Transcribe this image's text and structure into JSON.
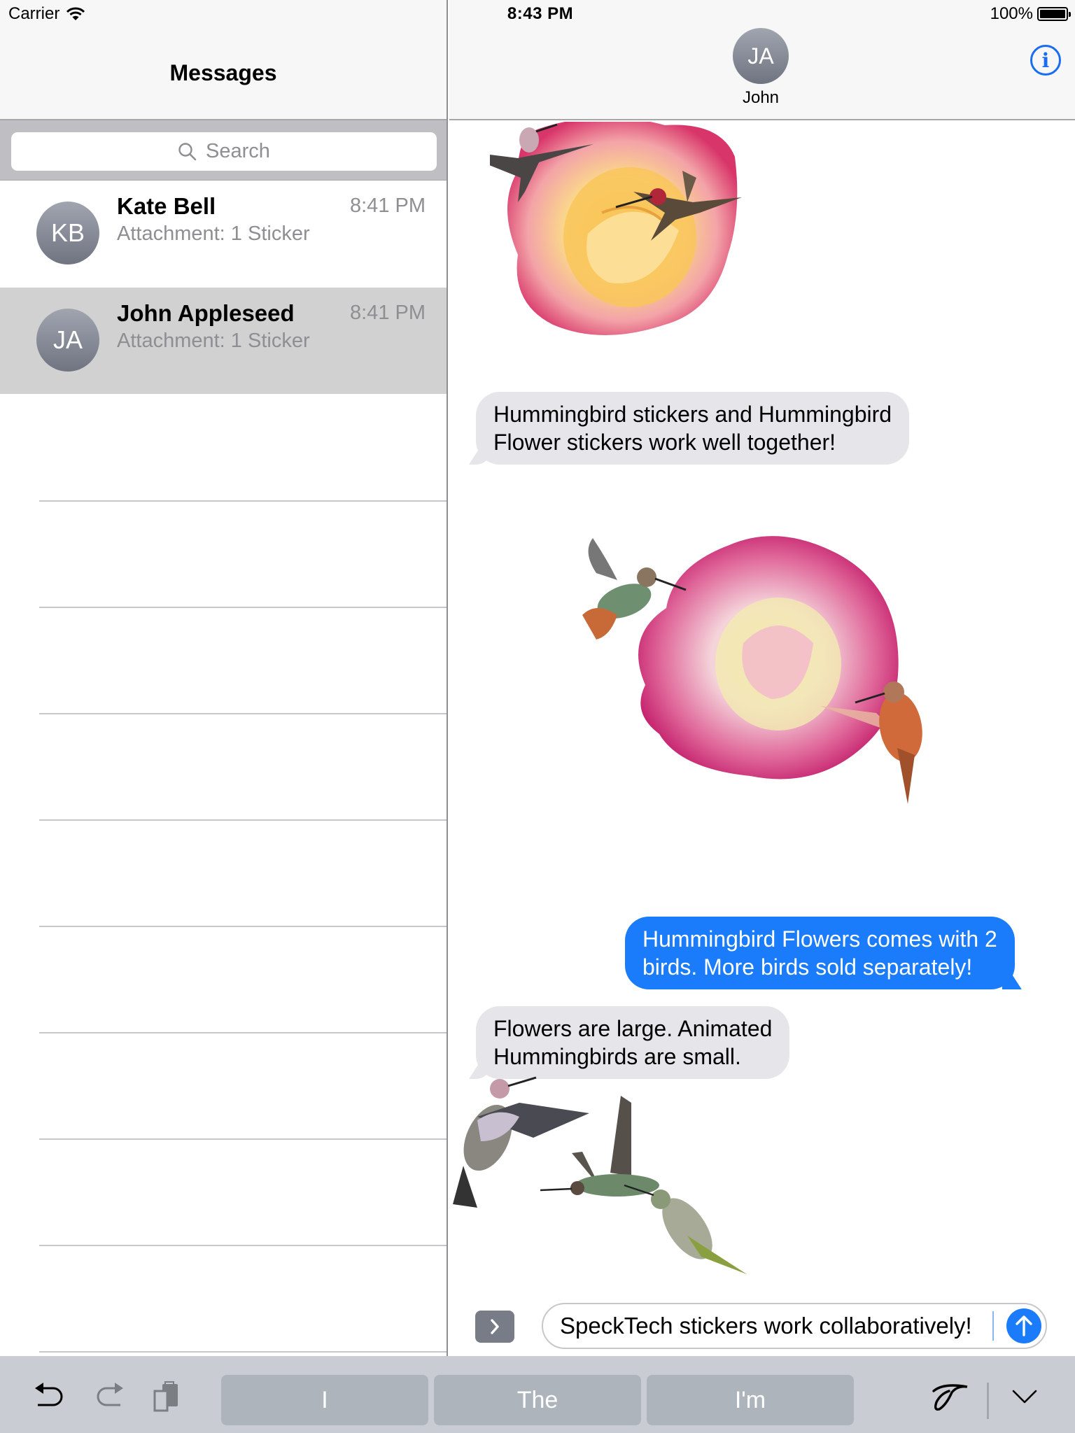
{
  "status_bar": {
    "carrier": "Carrier",
    "time": "8:43 PM",
    "battery_text": "100%",
    "battery_level": 1.0
  },
  "sidebar": {
    "title": "Messages",
    "search_placeholder": "Search",
    "conversations": [
      {
        "initials": "KB",
        "name": "Kate Bell",
        "time": "8:41 PM",
        "preview": "Attachment: 1 Sticker",
        "selected": false
      },
      {
        "initials": "JA",
        "name": "John Appleseed",
        "time": "8:41 PM",
        "preview": "Attachment: 1 Sticker",
        "selected": true
      }
    ]
  },
  "conversation": {
    "contact_initials": "JA",
    "contact_name": "John",
    "info_label": "i",
    "messages": [
      {
        "type": "sticker",
        "direction": "incoming",
        "description": "Yellow-pink rose with two hummingbirds"
      },
      {
        "type": "text",
        "direction": "incoming",
        "line1": "Hummingbird stickers and Hummingbird",
        "line2": "Flower stickers work well together!"
      },
      {
        "type": "sticker",
        "direction": "incoming",
        "description": "Magenta rose with two rufous hummingbirds"
      },
      {
        "type": "text",
        "direction": "outgoing",
        "line1": "Hummingbird Flowers comes with 2",
        "line2": "birds.  More birds sold separately!"
      },
      {
        "type": "text",
        "direction": "incoming",
        "line1": "Flowers are large.  Animated",
        "line2": "Hummingbirds are small."
      },
      {
        "type": "sticker",
        "direction": "incoming",
        "description": "Three hummingbirds in flight"
      }
    ]
  },
  "composer": {
    "value": "SpeckTech stickers work collaboratively!",
    "send_icon": "arrow-up-icon",
    "expand_icon": "chevron-right-icon"
  },
  "keyboard_bar": {
    "suggestions": [
      "I",
      "The",
      "I'm"
    ],
    "icons": [
      "undo-icon",
      "redo-icon",
      "paste-icon",
      "handwriting-icon",
      "dismiss-keyboard-icon"
    ]
  },
  "colors": {
    "accent": "#1a7cfa",
    "incoming_bubble": "#e5e5ea",
    "selected_row": "#d1d1d1",
    "keyboard_bar": "#c9ccd3",
    "suggestion_key": "#adb4bc"
  }
}
